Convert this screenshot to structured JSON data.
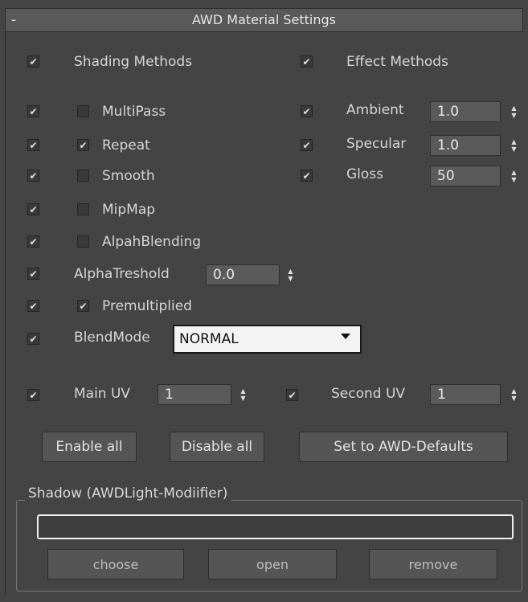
{
  "rollout": {
    "collapse_symbol": "-",
    "title": "AWD Material Settings"
  },
  "header_row": {
    "shading_methods": {
      "checked": true,
      "label": "Shading Methods"
    },
    "effect_methods": {
      "checked": true,
      "label": "Effect Methods"
    }
  },
  "left_rows": [
    {
      "enabled": true,
      "checked": false,
      "label": "MultiPass"
    },
    {
      "enabled": true,
      "checked": true,
      "label": "Repeat"
    },
    {
      "enabled": true,
      "checked": false,
      "label": "Smooth"
    },
    {
      "enabled": true,
      "checked": false,
      "label": "MipMap"
    },
    {
      "enabled": true,
      "checked": false,
      "label": "AlpahBlending"
    }
  ],
  "alpha_threshold": {
    "enabled": true,
    "label": "AlphaTreshold",
    "value": "0.0"
  },
  "premultiplied": {
    "enabled": true,
    "checked": true,
    "label": "Premultiplied"
  },
  "blend_mode": {
    "enabled": true,
    "label": "BlendMode",
    "value": "NORMAL"
  },
  "effects": [
    {
      "checked": true,
      "label": "Ambient",
      "value": "1.0"
    },
    {
      "checked": true,
      "label": "Specular",
      "value": "1.0"
    },
    {
      "checked": true,
      "label": "Gloss",
      "value": "50"
    }
  ],
  "uv": {
    "main": {
      "checked": true,
      "label": "Main UV",
      "value": "1"
    },
    "second": {
      "checked": true,
      "label": "Second UV",
      "value": "1"
    }
  },
  "buttons": {
    "enable_all": "Enable all",
    "disable_all": "Disable all",
    "defaults": "Set to AWD-Defaults"
  },
  "shadow": {
    "group_title": "Shadow (AWDLight-Modiifier)",
    "field_value": "",
    "choose": "choose",
    "open": "open",
    "remove": "remove"
  },
  "check_glyph": "✔",
  "colors": {
    "panel_bg": "#444444",
    "header_bg": "#595959",
    "field_bg": "#5a5a5a",
    "dropdown_bg": "#f3f3f3"
  }
}
